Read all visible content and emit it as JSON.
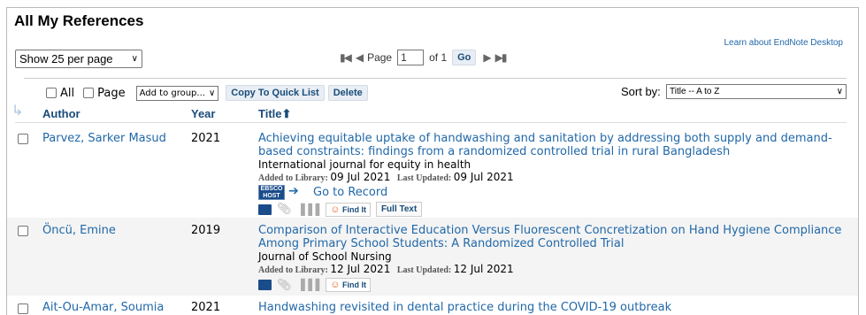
{
  "page": {
    "title": "All My References",
    "per_page": "Show 25 per page",
    "learn_link": "Learn about EndNote Desktop"
  },
  "pager": {
    "page_label": "Page",
    "page_value": "1",
    "of_label": "of 1",
    "go": "Go"
  },
  "toolbar": {
    "all_label": "All",
    "page_label": "Page",
    "add_group": "Add to group...",
    "copy_quick": "Copy To Quick List",
    "delete": "Delete",
    "sort_label": "Sort by:",
    "sort_value": "Title -- A to Z"
  },
  "columns": {
    "author": "Author",
    "year": "Year",
    "title": "Title⬆"
  },
  "labels": {
    "added": "Added to Library:",
    "updated": "Last Updated:",
    "goto": "Go to Record",
    "findit": "Find It",
    "fulltext": "Full Text",
    "ebsco": "EBSCO HOST"
  },
  "references": [
    {
      "author": "Parvez, Sarker Masud",
      "year": "2021",
      "title": "Achieving equitable uptake of handwashing and sanitation by addressing both supply and demand-based constraints: findings from a randomized controlled trial in rural Bangladesh",
      "journal": "International journal for equity in health",
      "added": "09 Jul 2021",
      "updated": "09 Jul 2021"
    },
    {
      "author": "Öncü, Emine",
      "year": "2019",
      "title": "Comparison of Interactive Education Versus Fluorescent Concretization on Hand Hygiene Compliance Among Primary School Students: A Randomized Controlled Trial",
      "journal": "Journal of School Nursing",
      "added": "12 Jul 2021",
      "updated": "12 Jul 2021"
    },
    {
      "author": "Ait-Ou-Amar, Soumia",
      "year": "2021",
      "title": "Handwashing revisited in dental practice during the COVID-19 outbreak"
    }
  ]
}
